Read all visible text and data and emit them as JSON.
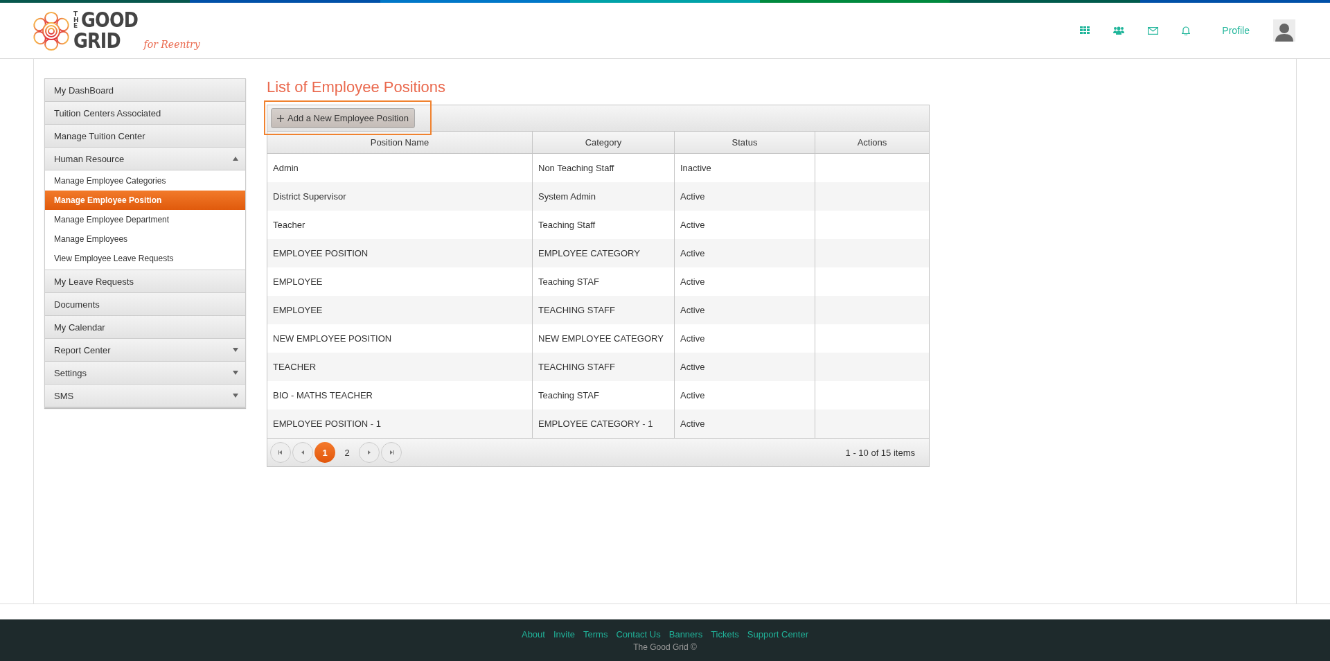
{
  "header": {
    "logo": {
      "top": "THE",
      "word1": "GOOD",
      "word2": "GRID",
      "tagline": "for Reentry"
    },
    "profile_label": "Profile"
  },
  "sidebar": {
    "items": [
      {
        "label": "My DashBoard"
      },
      {
        "label": "Tuition Centers Associated"
      },
      {
        "label": "Manage Tuition Center"
      },
      {
        "label": "Human Resource",
        "expanded": true,
        "children": [
          {
            "label": "Manage Employee Categories",
            "selected": false
          },
          {
            "label": "Manage Employee Position",
            "selected": true
          },
          {
            "label": "Manage Employee Department",
            "selected": false
          },
          {
            "label": "Manage Employees",
            "selected": false
          },
          {
            "label": "View Employee Leave Requests",
            "selected": false
          }
        ]
      },
      {
        "label": "My Leave Requests"
      },
      {
        "label": "Documents"
      },
      {
        "label": "My Calendar"
      },
      {
        "label": "Report Center",
        "expanded": false
      },
      {
        "label": "Settings",
        "expanded": false
      },
      {
        "label": "SMS",
        "expanded": false
      }
    ]
  },
  "page_title": "List of Employee Positions",
  "toolbar": {
    "add_button": "Add a New Employee Position"
  },
  "table": {
    "columns": [
      "Position Name",
      "Category",
      "Status",
      "Actions"
    ],
    "rows": [
      [
        "Admin",
        "Non Teaching Staff",
        "Inactive"
      ],
      [
        "District Supervisor",
        "System Admin",
        "Active"
      ],
      [
        "Teacher",
        "Teaching Staff",
        "Active"
      ],
      [
        "EMPLOYEE POSITION",
        "EMPLOYEE CATEGORY",
        "Active"
      ],
      [
        "EMPLOYEE",
        "Teaching STAF",
        "Active"
      ],
      [
        "EMPLOYEE",
        "TEACHING STAFF",
        "Active"
      ],
      [
        "NEW EMPLOYEE POSITION",
        "NEW EMPLOYEE CATEGORY",
        "Active"
      ],
      [
        "TEACHER",
        "TEACHING STAFF",
        "Active"
      ],
      [
        "BIO - MATHS TEACHER",
        "Teaching STAF",
        "Active"
      ],
      [
        "EMPLOYEE POSITION - 1",
        "EMPLOYEE CATEGORY - 1",
        "Active"
      ]
    ]
  },
  "pager": {
    "pages": [
      {
        "label": "1",
        "selected": true
      },
      {
        "label": "2",
        "selected": false
      }
    ],
    "info": "1 - 10 of 15 items"
  },
  "footer": {
    "links": [
      "About",
      "Invite",
      "Terms",
      "Contact Us",
      "Banners",
      "Tickets",
      "Support Center"
    ],
    "copyright": "The Good Grid ©"
  }
}
